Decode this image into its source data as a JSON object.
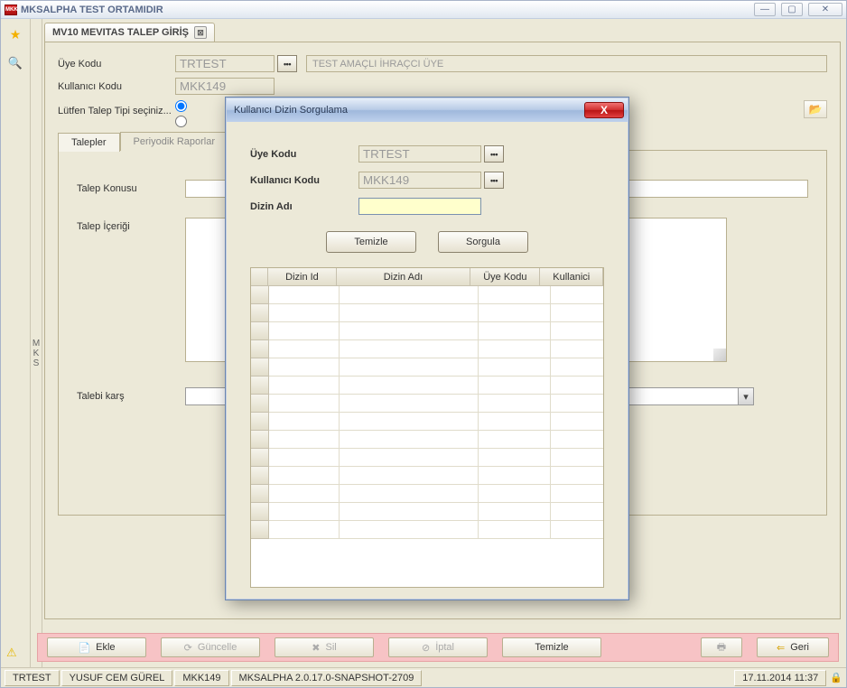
{
  "window": {
    "title": "MKSALPHA TEST ORTAMIDIR"
  },
  "tab": {
    "title": "MV10 MEVITAS TALEP GİRİŞ"
  },
  "form": {
    "uye_kodu_label": "Üye Kodu",
    "uye_kodu_value": "TRTEST",
    "uye_kodu_desc": "TEST AMAÇLI İHRAÇCI ÜYE",
    "kullanici_kodu_label": "Kullanıcı Kodu",
    "kullanici_kodu_value": "MKK149",
    "talep_tipi_label": "Lütfen Talep Tipi seçiniz..."
  },
  "tabs2": {
    "talepler": "Talepler",
    "periyodik": "Periyodik Raporlar"
  },
  "inner": {
    "talep_konusu": "Talep Konusu",
    "talep_icerigi": "Talep İçeriği",
    "talebi_kars": "Talebi karş"
  },
  "actions": {
    "ekle": "Ekle",
    "guncelle": "Güncelle",
    "sil": "Sil",
    "iptal": "İptal",
    "temizle": "Temizle",
    "geri": "Geri"
  },
  "status": {
    "cell1": "TRTEST",
    "cell2": "YUSUF CEM GÜREL",
    "cell3": "MKK149",
    "cell4": "MKSALPHA 2.0.17.0-SNAPSHOT-2709",
    "datetime": "17.11.2014 11:37"
  },
  "dialog": {
    "title": "Kullanıcı Dizin Sorgulama",
    "uye_kodu_label": "Üye Kodu",
    "uye_kodu_value": "TRTEST",
    "kullanici_kodu_label": "Kullanıcı Kodu",
    "kullanici_kodu_value": "MKK149",
    "dizin_adi_label": "Dizin Adı",
    "dizin_adi_value": "",
    "temizle": "Temizle",
    "sorgula": "Sorgula",
    "cols": {
      "dizin_id": "Dizin Id",
      "dizin_adi": "Dizin Adı",
      "uye_kodu": "Üye Kodu",
      "kullanici": "Kullanici"
    }
  },
  "midRail": "MKS"
}
